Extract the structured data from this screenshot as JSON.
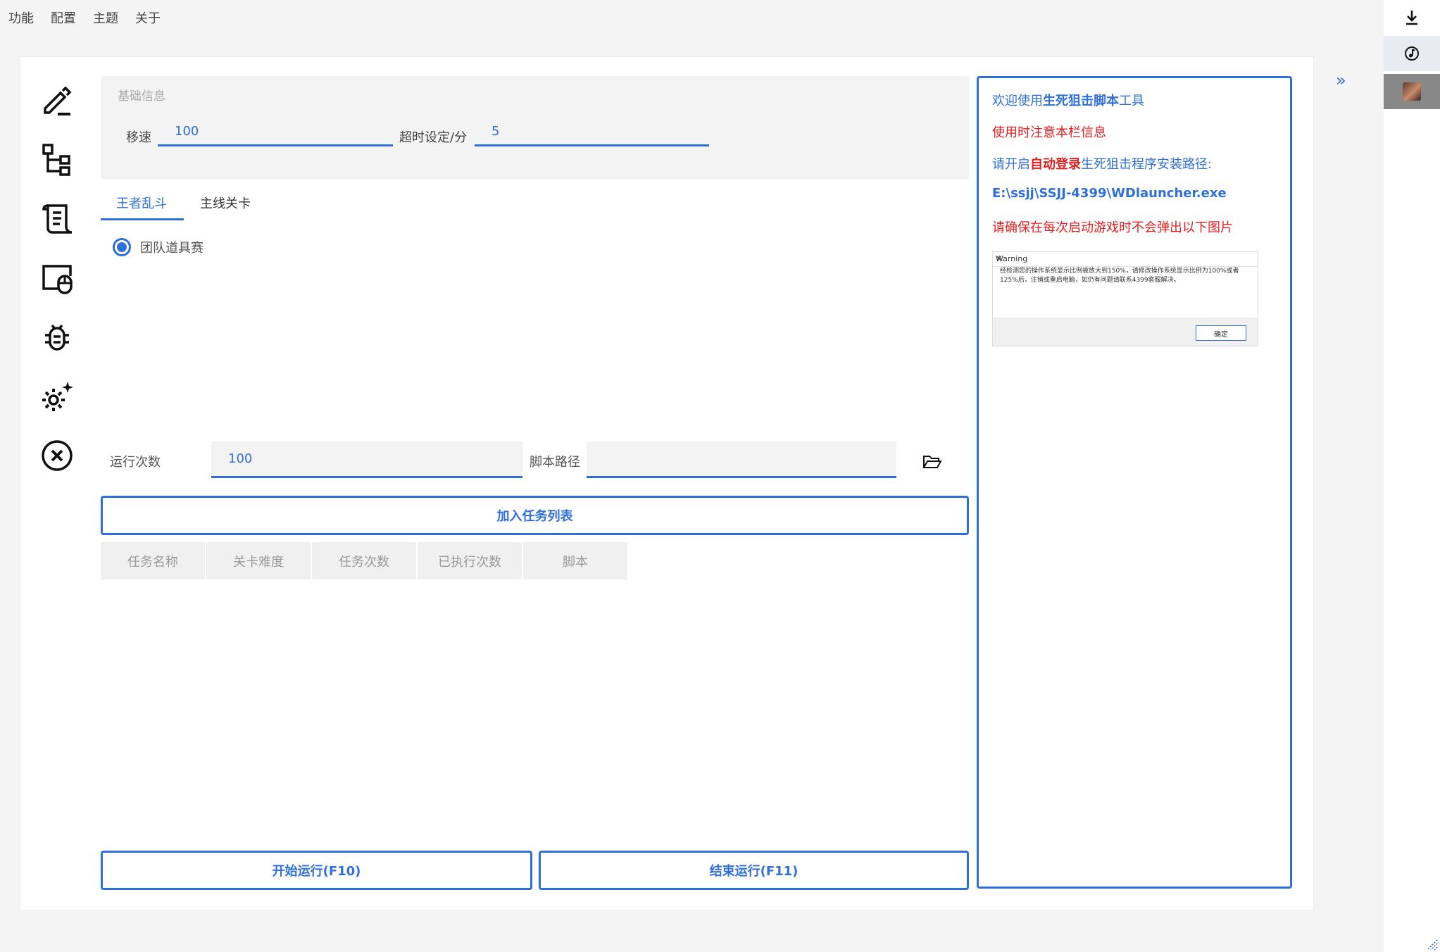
{
  "menu": [
    "功能",
    "配置",
    "主题",
    "关于"
  ],
  "sidebar_icons": [
    "edit-icon",
    "tree-icon",
    "scroll-icon",
    "window-mouse-icon",
    "bug-icon",
    "settings-sparkle-icon",
    "close-circle-icon"
  ],
  "basic_info": {
    "title": "基础信息",
    "speed_label": "移速",
    "speed_value": "100",
    "timeout_label": "超时设定/分",
    "timeout_value": "5"
  },
  "tabs": [
    "王者乱斗",
    "主线关卡"
  ],
  "radio_option": "团队道具赛",
  "run": {
    "count_label": "运行次数",
    "count_value": "100",
    "path_label": "脚本路径",
    "path_value": ""
  },
  "add_task_button": "加入任务列表",
  "table_headers": [
    "任务名称",
    "关卡难度",
    "任务次数",
    "已执行次数",
    "脚本"
  ],
  "start_button": "开始运行(F10)",
  "stop_button": "结束运行(F11)",
  "info_panel": {
    "line1_pre": "欢迎使用",
    "line1_bold": "生死狙击脚本",
    "line1_post": "工具",
    "line2": "使用时注意本栏信息",
    "line3_pre": "请开启",
    "line3_bold": "自动登录",
    "line3_post": "生死狙击程序安装路径:",
    "line4": "E:\\ssjj\\SSJJ-4399\\WDlauncher.exe",
    "line5": "请确保在每次启动游戏时不会弹出以下图片"
  },
  "warning_dialog": {
    "title": "Warning",
    "text": "经检测您的操作系统显示比例被放大到150%，请修改操作系统显示比例为100%或者125%后，注销或重启电脑，如仍有问题请联系4399客服解决。",
    "ok": "确定"
  },
  "colors": {
    "accent": "#2f6fdb",
    "warning_text": "#e02020"
  }
}
